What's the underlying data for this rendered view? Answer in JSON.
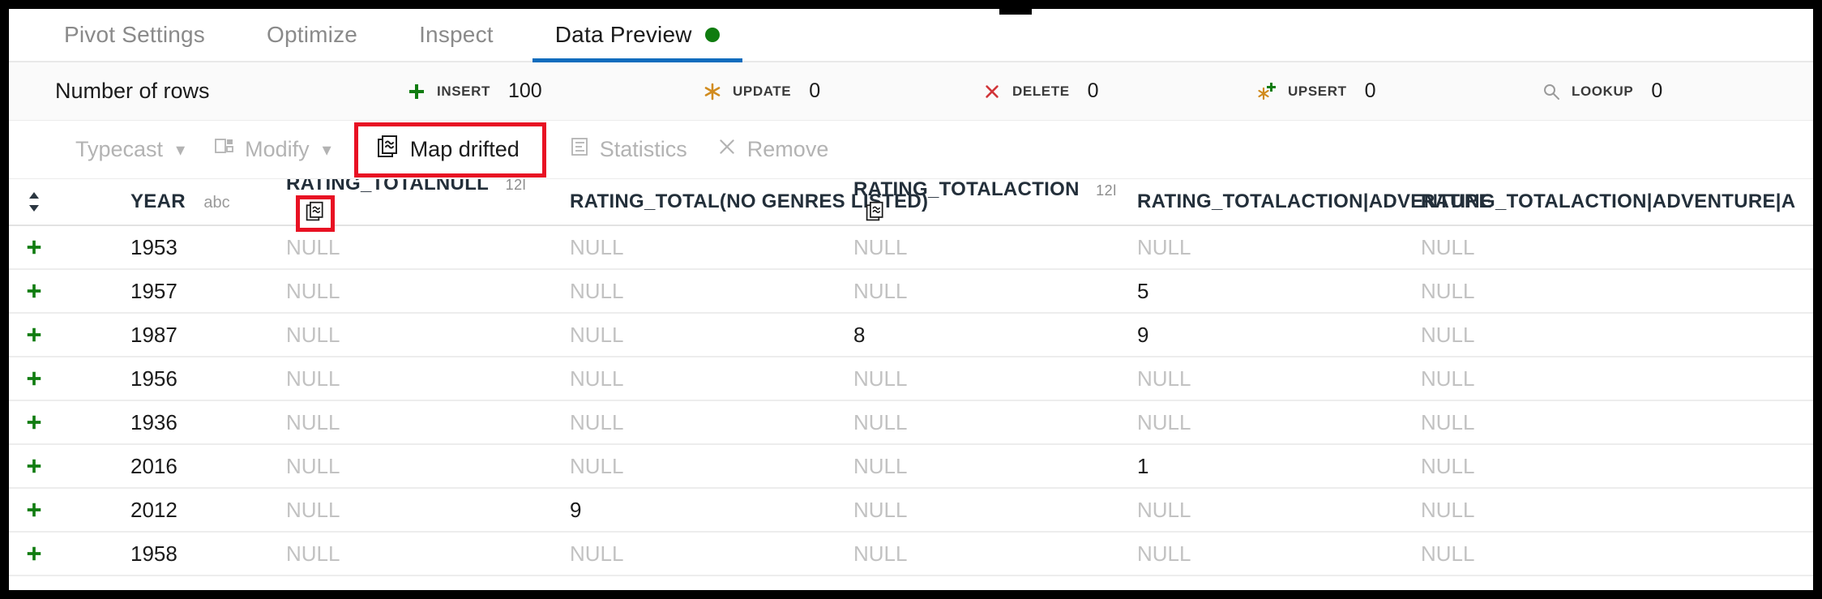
{
  "tabs": [
    {
      "label": "Pivot Settings",
      "active": false,
      "dot": false
    },
    {
      "label": "Optimize",
      "active": false,
      "dot": false
    },
    {
      "label": "Inspect",
      "active": false,
      "dot": false
    },
    {
      "label": "Data Preview",
      "active": true,
      "dot": true
    }
  ],
  "stats": {
    "title": "Number of rows",
    "items": [
      {
        "label": "INSERT",
        "value": "100",
        "icon": "plus-icon",
        "color": "#107c10"
      },
      {
        "label": "UPDATE",
        "value": "0",
        "icon": "asterisk-icon",
        "color": "#d18b1e"
      },
      {
        "label": "DELETE",
        "value": "0",
        "icon": "x-icon",
        "color": "#d13438"
      },
      {
        "label": "UPSERT",
        "value": "0",
        "icon": "asterisk-plus-icon",
        "color": "#d18b1e"
      },
      {
        "label": "LOOKUP",
        "value": "0",
        "icon": "search-icon",
        "color": "#9a9a9a"
      }
    ]
  },
  "toolbar": {
    "typecast": "Typecast",
    "modify": "Modify",
    "map_drifted": "Map drifted",
    "statistics": "Statistics",
    "remove": "Remove",
    "highlight_color": "#e81123"
  },
  "table": {
    "columns": [
      {
        "name": "YEAR",
        "type_badge": "abc",
        "drift": false,
        "highlight": false
      },
      {
        "name": "RATING_TOTALNULL",
        "type_badge": "12l",
        "drift": true,
        "highlight": true
      },
      {
        "name": "RATING_TOTAL(NO GENRES LISTED)",
        "type_badge": "",
        "drift": false,
        "highlight": false
      },
      {
        "name": "RATING_TOTALACTION",
        "type_badge": "12l",
        "drift": true,
        "highlight": false
      },
      {
        "name": "RATING_TOTALACTION|ADVENTURE",
        "type_badge": "",
        "drift": false,
        "highlight": false
      },
      {
        "name": "RATING_TOTALACTION|ADVENTURE|A",
        "type_badge": "",
        "drift": false,
        "highlight": false
      }
    ],
    "null_text": "NULL",
    "rows": [
      {
        "year": "1953",
        "c1": "NULL",
        "c2": "NULL",
        "c3": "NULL",
        "c4": "NULL",
        "c5": "NULL"
      },
      {
        "year": "1957",
        "c1": "NULL",
        "c2": "NULL",
        "c3": "NULL",
        "c4": "5",
        "c5": "NULL"
      },
      {
        "year": "1987",
        "c1": "NULL",
        "c2": "NULL",
        "c3": "8",
        "c4": "9",
        "c5": "NULL"
      },
      {
        "year": "1956",
        "c1": "NULL",
        "c2": "NULL",
        "c3": "NULL",
        "c4": "NULL",
        "c5": "NULL"
      },
      {
        "year": "1936",
        "c1": "NULL",
        "c2": "NULL",
        "c3": "NULL",
        "c4": "NULL",
        "c5": "NULL"
      },
      {
        "year": "2016",
        "c1": "NULL",
        "c2": "NULL",
        "c3": "NULL",
        "c4": "1",
        "c5": "NULL"
      },
      {
        "year": "2012",
        "c1": "NULL",
        "c2": "9",
        "c3": "NULL",
        "c4": "NULL",
        "c5": "NULL"
      },
      {
        "year": "1958",
        "c1": "NULL",
        "c2": "NULL",
        "c3": "NULL",
        "c4": "NULL",
        "c5": "NULL"
      }
    ]
  }
}
